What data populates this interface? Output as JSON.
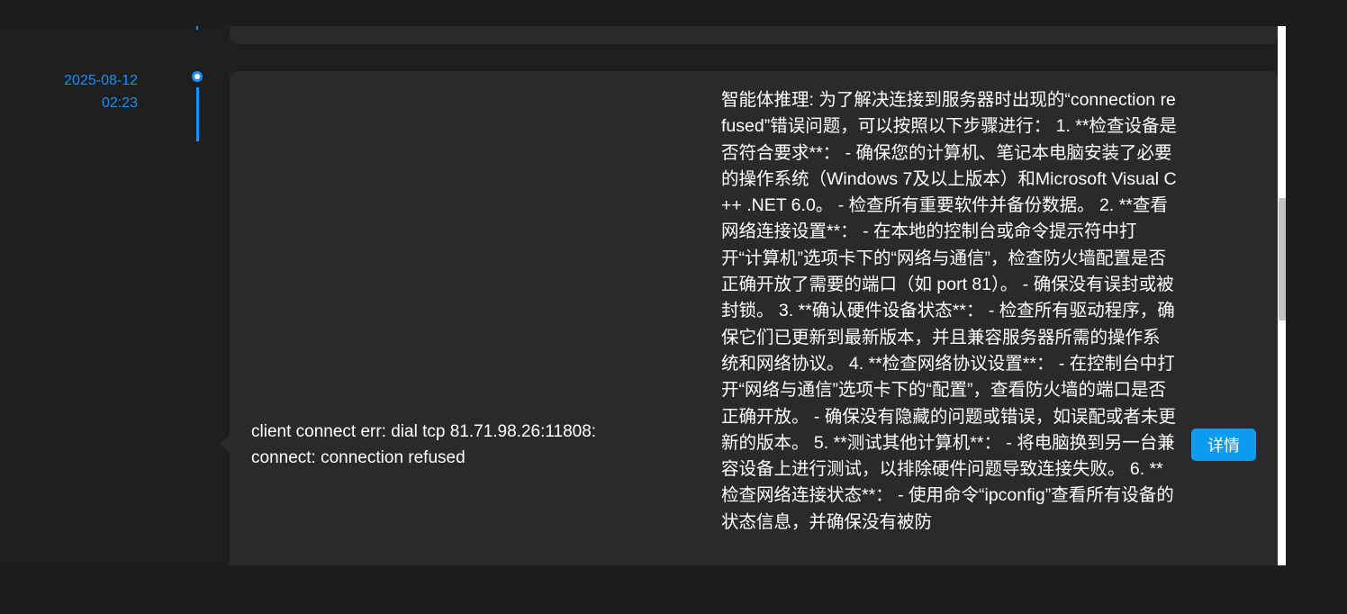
{
  "entry": {
    "date": "2025-08-12",
    "time": "02:23",
    "error_message": "client connect err: dial tcp 81.71.98.26:11808: connect: connection refused",
    "reasoning": "智能体推理: 为了解决连接到服务器时出现的“connection refused”错误问题，可以按照以下步骤进行： 1. **检查设备是否符合要求**： - 确保您的计算机、笔记本电脑安装了必要的操作系统（Windows 7及以上版本）和Microsoft Visual C++ .NET 6.0。 - 检查所有重要软件并备份数据。 2. **查看网络连接设置**： - 在本地的控制台或命令提示符中打开“计算机”选项卡下的“网络与通信”，检查防火墙配置是否正确开放了需要的端口（如 port 81）。 - 确保没有误封或被封锁。 3. **确认硬件设备状态**： - 检查所有驱动程序，确保它们已更新到最新版本，并且兼容服务器所需的操作系统和网络协议。 4. **检查网络协议设置**： - 在控制台中打开“网络与通信”选项卡下的“配置”，查看防火墙的端口是否正确开放。 - 确保没有隐藏的问题或错误，如误配或者未更新的版本。 5. **测试其他计算机**： - 将电脑换到另一台兼容设备上进行测试，以排除硬件问题导致连接失败。 6. **检查网络连接状态**： - 使用命令“ipconfig”查看所有设备的状态信息，并确保没有被防",
    "detail_button": "详情"
  },
  "colors": {
    "accent": "#1890ff",
    "button": "#0a9cf0",
    "card": "#2a2a2a",
    "background": "#1d1d1d"
  }
}
